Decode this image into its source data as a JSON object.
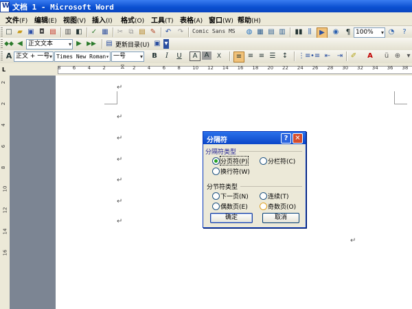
{
  "window": {
    "title": "文档 1 - Microsoft Word"
  },
  "menu": [
    {
      "label": "文件",
      "key": "(F)"
    },
    {
      "label": "编辑",
      "key": "(E)"
    },
    {
      "label": "视图",
      "key": "(V)"
    },
    {
      "label": "插入",
      "key": "(I)"
    },
    {
      "label": "格式",
      "key": "(O)"
    },
    {
      "label": "工具",
      "key": "(T)"
    },
    {
      "label": "表格",
      "key": "(A)"
    },
    {
      "label": "窗口",
      "key": "(W)"
    },
    {
      "label": "帮助",
      "key": "(H)"
    }
  ],
  "toolbar1": {
    "font_preview": "Comic Sans MS",
    "zoom": "100%"
  },
  "toolbar2": {
    "style": "正文文本",
    "update_toc": "更新目录",
    "update_toc_key": "(U)"
  },
  "toolbar3": {
    "style": "正文 + 一号",
    "font": "Times New Roman",
    "size": "一号"
  },
  "ruler": {
    "h_numbers": [
      "8",
      "6",
      "4",
      "2",
      "",
      "2",
      "4",
      "6",
      "8",
      "10",
      "12",
      "14",
      "16",
      "18",
      "20",
      "22",
      "24",
      "26",
      "28",
      "30",
      "32",
      "34",
      "36",
      "38",
      "40"
    ],
    "v_numbers": [
      "2",
      "2",
      "4",
      "6",
      "8",
      "10",
      "12",
      "14",
      "16"
    ]
  },
  "document": {
    "paragraph_mark": "↵"
  },
  "dialog": {
    "title": "分隔符",
    "group1_label": "分隔符类型",
    "group2_label": "分节符类型",
    "options": {
      "page_break": "分页符(P)",
      "column_break": "分栏符(C)",
      "text_wrap_break": "换行符(W)",
      "next_page": "下一页(N)",
      "continuous": "连续(T)",
      "even_page": "偶数页(E)",
      "odd_page": "奇数页(O)"
    },
    "selected": "page_break",
    "ok": "确定",
    "cancel": "取消"
  }
}
